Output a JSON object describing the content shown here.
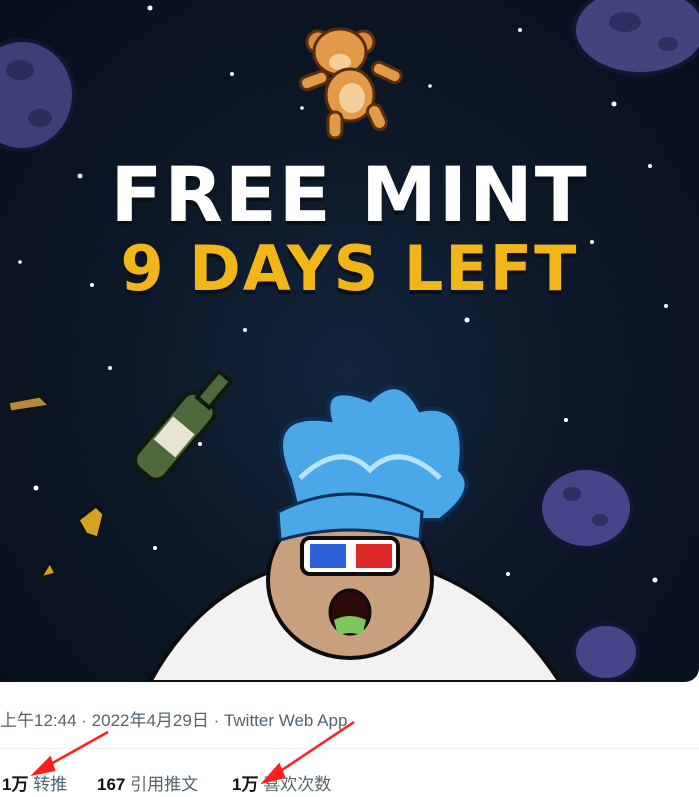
{
  "image": {
    "headline_line1": "FREE MINT",
    "headline_line2": "9 DAYS LEFT",
    "colors": {
      "background": "#0c1828",
      "headline": "#ffffff",
      "subheadline": "#f2b619",
      "hair": "#4aa7e8"
    }
  },
  "meta": {
    "time": "上午12:44",
    "separator1": " · ",
    "date": "2022年4月29日",
    "separator2": " · ",
    "source": "Twitter Web App"
  },
  "stats": {
    "retweets_count": "1万",
    "retweets_label": "转推",
    "quotes_count": "167",
    "quotes_label": "引用推文",
    "likes_count": "1万",
    "likes_label": "喜欢次数"
  },
  "annotations": {
    "arrow_color": "#ff1f1f"
  }
}
